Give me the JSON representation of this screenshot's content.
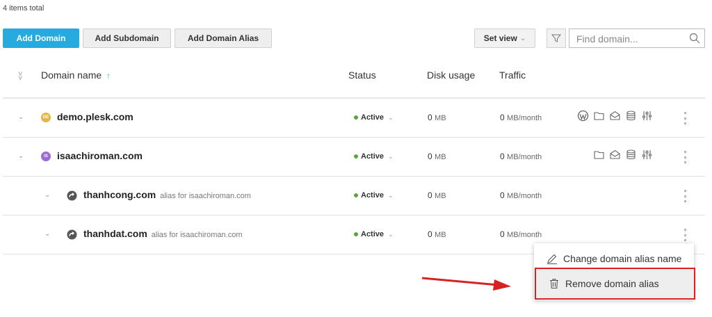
{
  "summary": {
    "total": "4 items total"
  },
  "toolbar": {
    "add_domain": "Add Domain",
    "add_subdomain": "Add Subdomain",
    "add_alias": "Add Domain Alias",
    "set_view": "Set view",
    "search_placeholder": "Find domain..."
  },
  "columns": {
    "domain": "Domain name",
    "sort_indicator": "↑",
    "status": "Status",
    "disk": "Disk usage",
    "traffic": "Traffic"
  },
  "rows": [
    {
      "name": "demo.plesk.com",
      "favicon": "DE",
      "favicon_color": "#e3b648",
      "alias_of": "",
      "status": "Active",
      "disk_value": "0",
      "disk_unit": "MB",
      "traffic_value": "0",
      "traffic_unit": "MB/month"
    },
    {
      "name": "isaachiroman.com",
      "favicon": "IS",
      "favicon_color": "#9b6bd4",
      "alias_of": "",
      "status": "Active",
      "disk_value": "0",
      "disk_unit": "MB",
      "traffic_value": "0",
      "traffic_unit": "MB/month"
    },
    {
      "name": "thanhcong.com",
      "favicon": "",
      "alias_of": "alias for isaachiroman.com",
      "status": "Active",
      "disk_value": "0",
      "disk_unit": "MB",
      "traffic_value": "0",
      "traffic_unit": "MB/month"
    },
    {
      "name": "thanhdat.com",
      "favicon": "",
      "alias_of": "alias for isaachiroman.com",
      "status": "Active",
      "disk_value": "0",
      "disk_unit": "MB",
      "traffic_value": "0",
      "traffic_unit": "MB/month"
    }
  ],
  "context_menu": {
    "change_alias": "Change domain alias name",
    "remove_alias": "Remove domain alias"
  },
  "colors": {
    "primary": "#28aade",
    "active": "#5aa53c",
    "highlight": "#d62222"
  }
}
